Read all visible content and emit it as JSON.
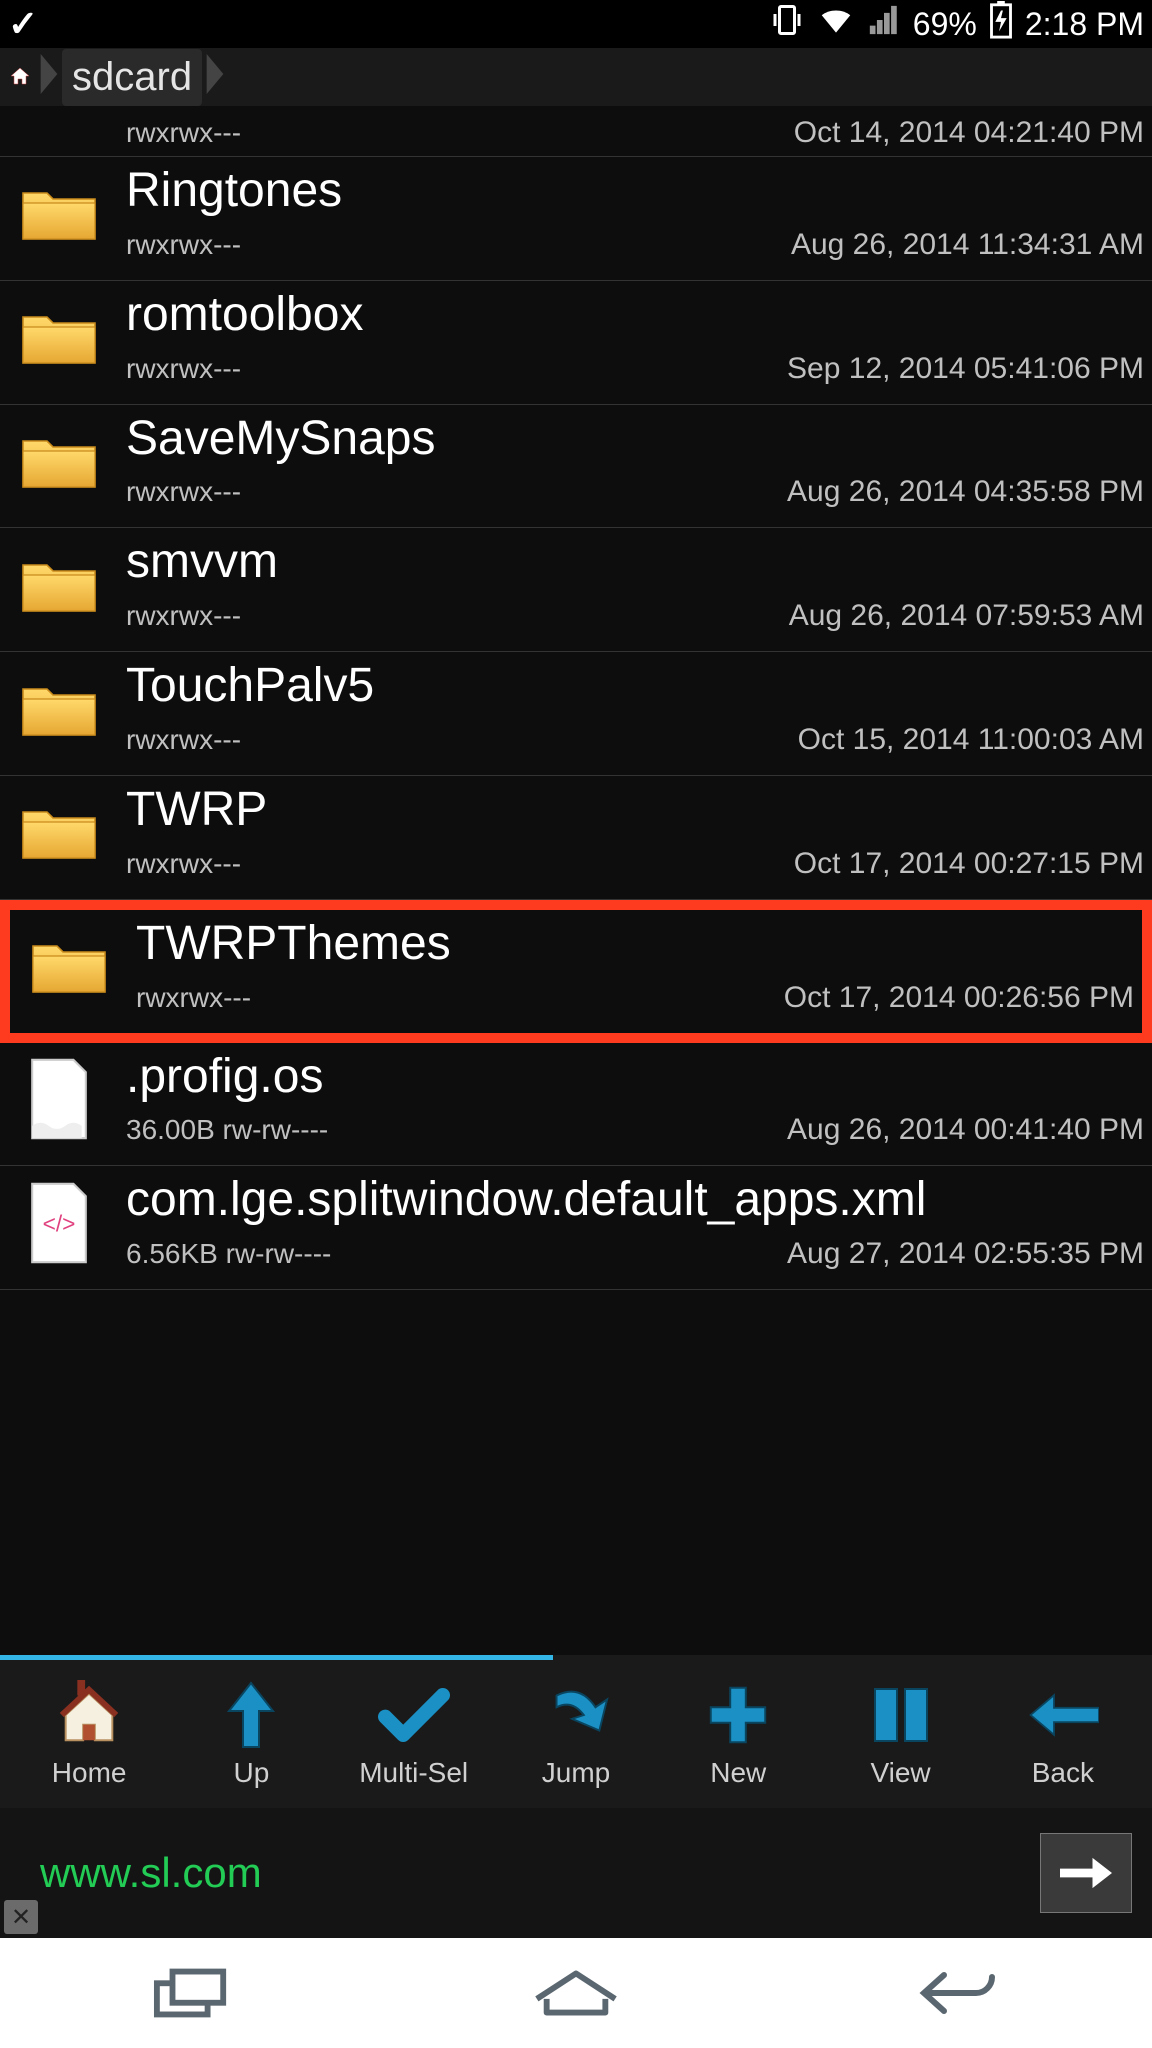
{
  "status": {
    "battery": "69%",
    "time": "2:18 PM"
  },
  "breadcrumb": {
    "path": "sdcard"
  },
  "files": [
    {
      "name": "",
      "perms": "rwxrwx---",
      "date": "Oct 14, 2014 04:21:40 PM",
      "type": "folder-partial"
    },
    {
      "name": "Ringtones",
      "perms": "rwxrwx---",
      "date": "Aug 26, 2014 11:34:31 AM",
      "type": "folder"
    },
    {
      "name": "romtoolbox",
      "perms": "rwxrwx---",
      "date": "Sep 12, 2014 05:41:06 PM",
      "type": "folder"
    },
    {
      "name": "SaveMySnaps",
      "perms": "rwxrwx---",
      "date": "Aug 26, 2014 04:35:58 PM",
      "type": "folder"
    },
    {
      "name": "smvvm",
      "perms": "rwxrwx---",
      "date": "Aug 26, 2014 07:59:53 AM",
      "type": "folder"
    },
    {
      "name": "TouchPalv5",
      "perms": "rwxrwx---",
      "date": "Oct 15, 2014 11:00:03 AM",
      "type": "folder"
    },
    {
      "name": "TWRP",
      "perms": "rwxrwx---",
      "date": "Oct 17, 2014 00:27:15 PM",
      "type": "folder"
    },
    {
      "name": "TWRPThemes",
      "perms": "rwxrwx---",
      "date": "Oct 17, 2014 00:26:56 PM",
      "type": "folder",
      "highlight": true
    },
    {
      "name": ".profig.os",
      "perms": "36.00B rw-rw----",
      "date": "Aug 26, 2014 00:41:40 PM",
      "type": "file-blank"
    },
    {
      "name": "com.lge.splitwindow.default_apps.xml",
      "perms": "6.56KB rw-rw----",
      "date": "Aug 27, 2014 02:55:35 PM",
      "type": "file-xml"
    }
  ],
  "toolbar": [
    {
      "id": "home",
      "label": "Home"
    },
    {
      "id": "up",
      "label": "Up"
    },
    {
      "id": "multisel",
      "label": "Multi-Sel"
    },
    {
      "id": "jump",
      "label": "Jump"
    },
    {
      "id": "new",
      "label": "New"
    },
    {
      "id": "view",
      "label": "View"
    },
    {
      "id": "back",
      "label": "Back"
    }
  ],
  "ad": {
    "text": "www.sl.com"
  }
}
